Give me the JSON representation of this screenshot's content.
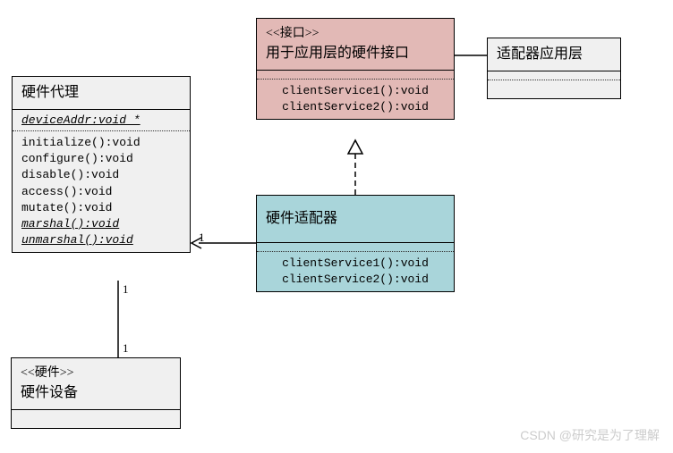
{
  "classes": {
    "hwProxy": {
      "title": "硬件代理",
      "attributes": [
        "deviceAddr:void *"
      ],
      "operations": [
        "initialize():void",
        "configure():void",
        "disable():void",
        "access():void",
        "mutate():void",
        "marshal():void",
        "unmarshal():void"
      ]
    },
    "hwInterface": {
      "stereotype": "<<接口>>",
      "title": "用于应用层的硬件接口",
      "operations": [
        "clientService1():void",
        "clientService2():void"
      ]
    },
    "adapterApp": {
      "title": "适配器应用层"
    },
    "hwAdapter": {
      "title": "硬件适配器",
      "operations": [
        "clientService1():void",
        "clientService2():void"
      ]
    },
    "hwDevice": {
      "stereotype": "<<硬件>>",
      "title": "硬件设备"
    }
  },
  "multiplicities": {
    "adapterProxy": "1",
    "proxyDeviceTop": "1",
    "proxyDeviceBottom": "1"
  },
  "watermark": "CSDN @研究是为了理解"
}
